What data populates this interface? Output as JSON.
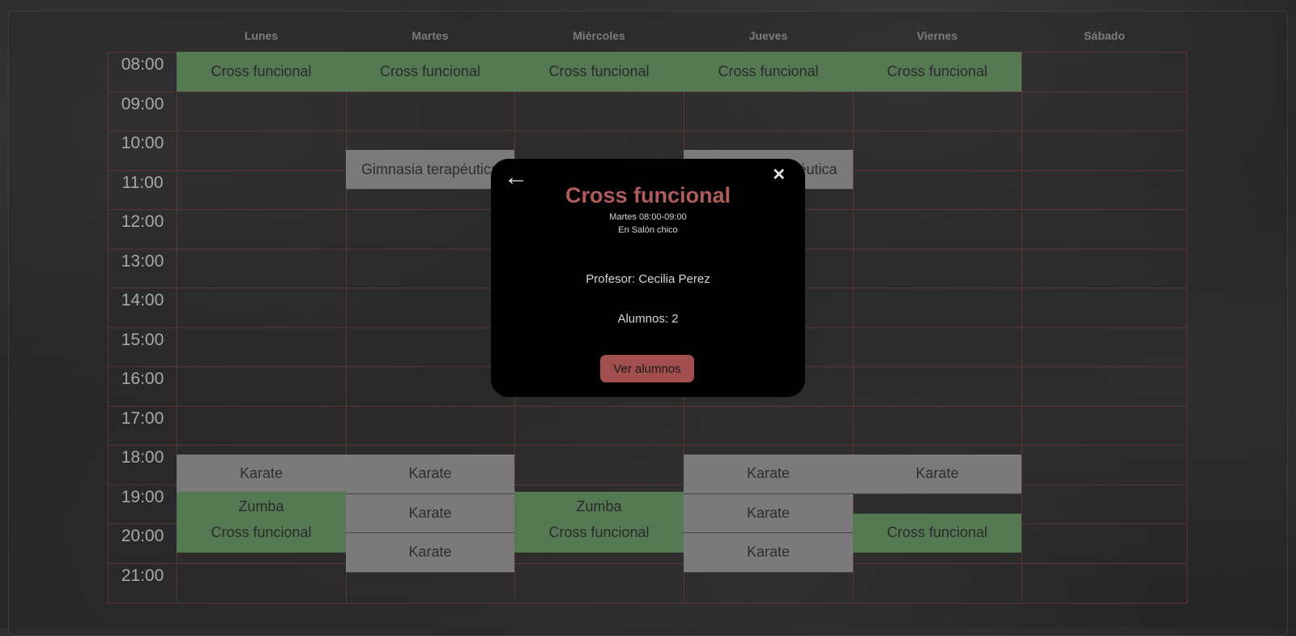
{
  "days": [
    "Lunes",
    "Martes",
    "Miércoles",
    "Jueves",
    "Viernes",
    "Sábado"
  ],
  "times": [
    "08:00",
    "09:00",
    "10:00",
    "11:00",
    "12:00",
    "13:00",
    "14:00",
    "15:00",
    "16:00",
    "17:00",
    "18:00",
    "19:00",
    "20:00",
    "21:00"
  ],
  "classes": [
    {
      "name": "Cross funcional",
      "day": "Lunes",
      "time": "08:00",
      "color": "green"
    },
    {
      "name": "Cross funcional",
      "day": "Martes",
      "time": "08:00",
      "color": "green"
    },
    {
      "name": "Cross funcional",
      "day": "Miércoles",
      "time": "08:00",
      "color": "green"
    },
    {
      "name": "Cross funcional",
      "day": "Jueves",
      "time": "08:00",
      "color": "green"
    },
    {
      "name": "Cross funcional",
      "day": "Viernes",
      "time": "08:00",
      "color": "green"
    },
    {
      "name": "Gimnasia terapéutica",
      "day": "Martes",
      "time": "10:30",
      "color": "gray"
    },
    {
      "name": "Gimnasia terapéutica",
      "day": "Jueves",
      "time": "10:30",
      "color": "gray"
    },
    {
      "name": "Karate",
      "day": "Lunes",
      "time": "18:15",
      "color": "gray"
    },
    {
      "name": "Karate",
      "day": "Martes",
      "time": "18:15",
      "color": "gray"
    },
    {
      "name": "Karate",
      "day": "Jueves",
      "time": "18:15",
      "color": "gray"
    },
    {
      "name": "Karate",
      "day": "Viernes",
      "time": "18:15",
      "color": "gray"
    },
    {
      "name": "Zumba",
      "day": "Lunes",
      "time": "19:15",
      "color": "green"
    },
    {
      "name": "Zumba",
      "day": "Miércoles",
      "time": "19:15",
      "color": "green"
    },
    {
      "name": "Karate",
      "day": "Martes",
      "time": "19:15",
      "color": "gray"
    },
    {
      "name": "Karate",
      "day": "Jueves",
      "time": "19:15",
      "color": "gray"
    },
    {
      "name": "Cross funcional",
      "day": "Lunes",
      "time": "20:00",
      "color": "green"
    },
    {
      "name": "Cross funcional",
      "day": "Miércoles",
      "time": "20:00",
      "color": "green"
    },
    {
      "name": "Cross funcional",
      "day": "Viernes",
      "time": "20:00",
      "color": "green"
    },
    {
      "name": "Karate",
      "day": "Martes",
      "time": "20:15",
      "color": "gray"
    },
    {
      "name": "Karate",
      "day": "Jueves",
      "time": "20:15",
      "color": "gray"
    }
  ],
  "modal": {
    "back_icon": "←",
    "close_icon": "✕",
    "title": "Cross funcional",
    "schedule": "Martes 08:00-09:00",
    "location": "En Salón chico",
    "teacher": "Profesor: Cecilia Perez",
    "students": "Alumnos: 2",
    "button_label": "Ver alumnos"
  },
  "colors": {
    "green": "#557a53",
    "gray": "#7a7a7a",
    "accent": "#b05c5c",
    "button": "#a04e4e",
    "grid_line": "#5a3636"
  }
}
